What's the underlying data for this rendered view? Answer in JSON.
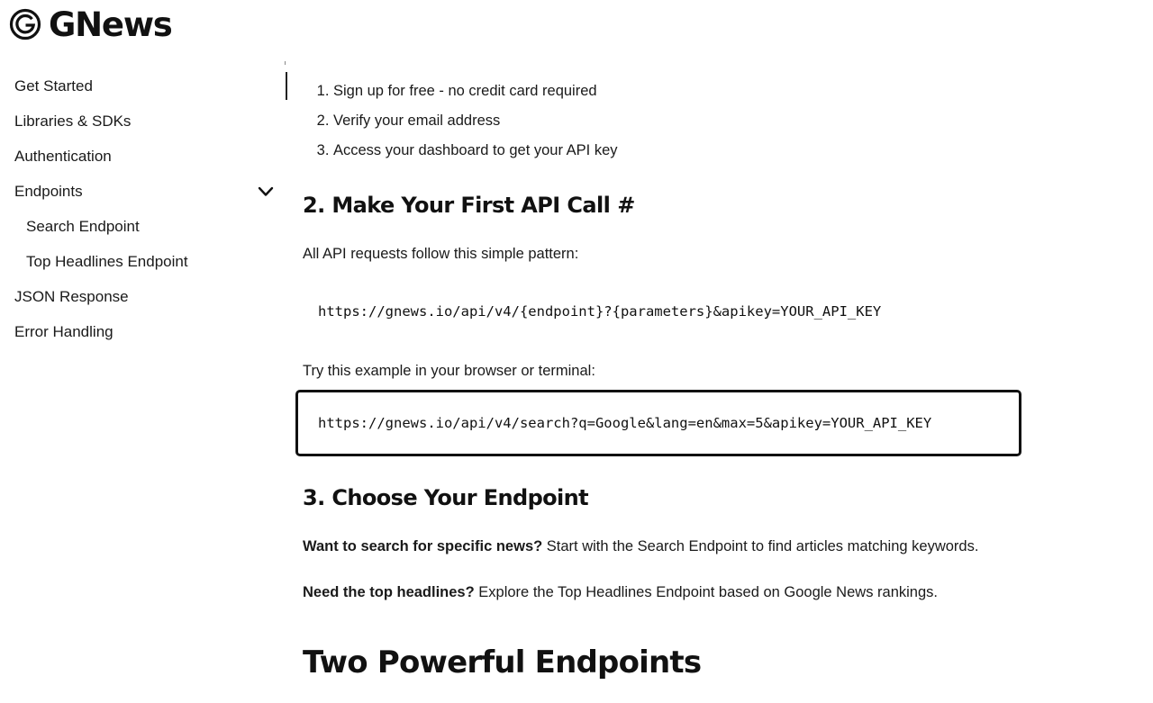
{
  "brand": {
    "name": "GNews",
    "logo_icon": "gnews-g-icon"
  },
  "sidebar": {
    "items": [
      {
        "label": "Get Started"
      },
      {
        "label": "Libraries & SDKs"
      },
      {
        "label": "Authentication"
      },
      {
        "label": "Endpoints",
        "icon": "chevron-down-icon",
        "expanded": true
      },
      {
        "label": "Search Endpoint"
      },
      {
        "label": "Top Headlines Endpoint"
      },
      {
        "label": "JSON Response"
      },
      {
        "label": "Error Handling"
      }
    ]
  },
  "main": {
    "steps": [
      "Sign up for free - no credit card required",
      "Verify your email address",
      "Access your dashboard to get your API key"
    ],
    "section2": {
      "title": "2. Make Your First API Call",
      "anchor": "#",
      "intro": "All API requests follow this simple pattern:",
      "pattern": "https://gnews.io/api/v4/{endpoint}?{parameters}&apikey=YOUR_API_KEY",
      "example_intro": "Try this example in your browser or terminal:",
      "example": "https://gnews.io/api/v4/search?q=Google&lang=en&max=5&apikey=YOUR_API_KEY"
    },
    "section3": {
      "title": "3. Choose Your Endpoint",
      "p1_bold": "Want to search for specific news?",
      "p1_rest": " Start with the Search Endpoint to find articles matching keywords.",
      "p2_bold": "Need the top headlines?",
      "p2_rest": " Explore the Top Headlines Endpoint based on Google News rankings."
    },
    "next_heading": "Two Powerful Endpoints"
  }
}
